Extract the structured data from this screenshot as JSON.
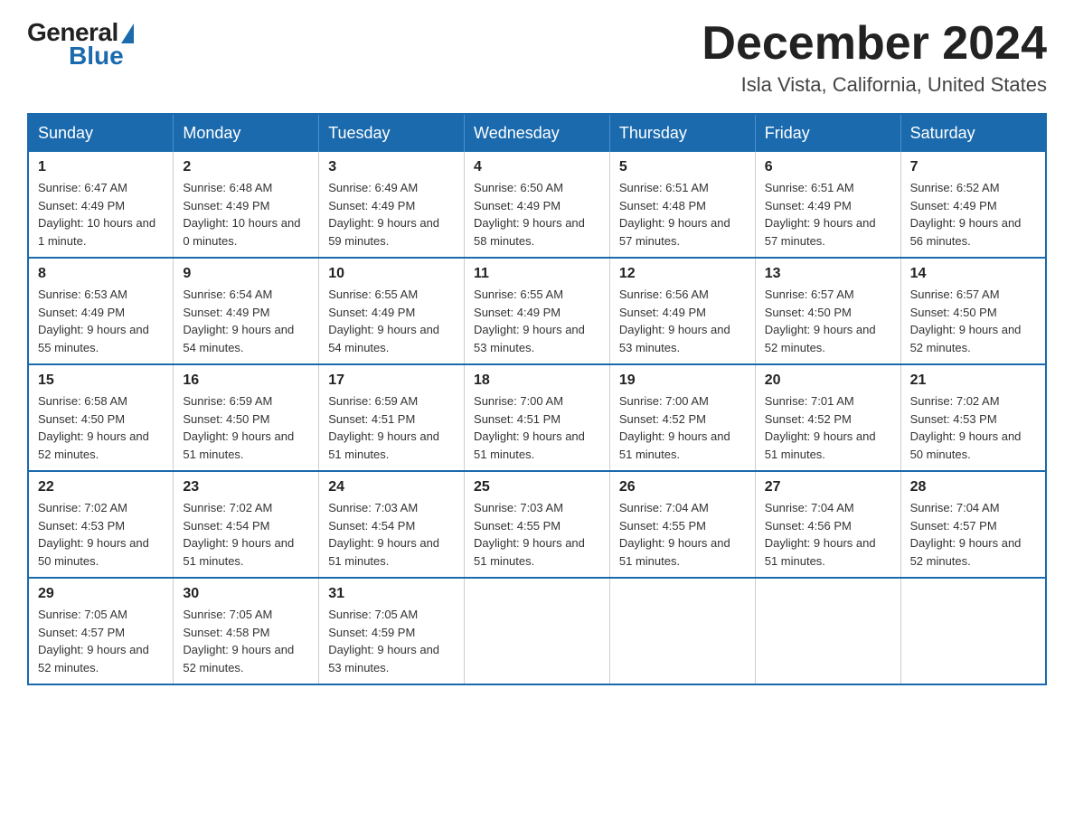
{
  "header": {
    "logo_general": "General",
    "logo_blue": "Blue",
    "month_title": "December 2024",
    "location": "Isla Vista, California, United States"
  },
  "weekdays": [
    "Sunday",
    "Monday",
    "Tuesday",
    "Wednesday",
    "Thursday",
    "Friday",
    "Saturday"
  ],
  "weeks": [
    [
      {
        "day": "1",
        "sunrise": "6:47 AM",
        "sunset": "4:49 PM",
        "daylight": "10 hours and 1 minute."
      },
      {
        "day": "2",
        "sunrise": "6:48 AM",
        "sunset": "4:49 PM",
        "daylight": "10 hours and 0 minutes."
      },
      {
        "day": "3",
        "sunrise": "6:49 AM",
        "sunset": "4:49 PM",
        "daylight": "9 hours and 59 minutes."
      },
      {
        "day": "4",
        "sunrise": "6:50 AM",
        "sunset": "4:49 PM",
        "daylight": "9 hours and 58 minutes."
      },
      {
        "day": "5",
        "sunrise": "6:51 AM",
        "sunset": "4:48 PM",
        "daylight": "9 hours and 57 minutes."
      },
      {
        "day": "6",
        "sunrise": "6:51 AM",
        "sunset": "4:49 PM",
        "daylight": "9 hours and 57 minutes."
      },
      {
        "day": "7",
        "sunrise": "6:52 AM",
        "sunset": "4:49 PM",
        "daylight": "9 hours and 56 minutes."
      }
    ],
    [
      {
        "day": "8",
        "sunrise": "6:53 AM",
        "sunset": "4:49 PM",
        "daylight": "9 hours and 55 minutes."
      },
      {
        "day": "9",
        "sunrise": "6:54 AM",
        "sunset": "4:49 PM",
        "daylight": "9 hours and 54 minutes."
      },
      {
        "day": "10",
        "sunrise": "6:55 AM",
        "sunset": "4:49 PM",
        "daylight": "9 hours and 54 minutes."
      },
      {
        "day": "11",
        "sunrise": "6:55 AM",
        "sunset": "4:49 PM",
        "daylight": "9 hours and 53 minutes."
      },
      {
        "day": "12",
        "sunrise": "6:56 AM",
        "sunset": "4:49 PM",
        "daylight": "9 hours and 53 minutes."
      },
      {
        "day": "13",
        "sunrise": "6:57 AM",
        "sunset": "4:50 PM",
        "daylight": "9 hours and 52 minutes."
      },
      {
        "day": "14",
        "sunrise": "6:57 AM",
        "sunset": "4:50 PM",
        "daylight": "9 hours and 52 minutes."
      }
    ],
    [
      {
        "day": "15",
        "sunrise": "6:58 AM",
        "sunset": "4:50 PM",
        "daylight": "9 hours and 52 minutes."
      },
      {
        "day": "16",
        "sunrise": "6:59 AM",
        "sunset": "4:50 PM",
        "daylight": "9 hours and 51 minutes."
      },
      {
        "day": "17",
        "sunrise": "6:59 AM",
        "sunset": "4:51 PM",
        "daylight": "9 hours and 51 minutes."
      },
      {
        "day": "18",
        "sunrise": "7:00 AM",
        "sunset": "4:51 PM",
        "daylight": "9 hours and 51 minutes."
      },
      {
        "day": "19",
        "sunrise": "7:00 AM",
        "sunset": "4:52 PM",
        "daylight": "9 hours and 51 minutes."
      },
      {
        "day": "20",
        "sunrise": "7:01 AM",
        "sunset": "4:52 PM",
        "daylight": "9 hours and 51 minutes."
      },
      {
        "day": "21",
        "sunrise": "7:02 AM",
        "sunset": "4:53 PM",
        "daylight": "9 hours and 50 minutes."
      }
    ],
    [
      {
        "day": "22",
        "sunrise": "7:02 AM",
        "sunset": "4:53 PM",
        "daylight": "9 hours and 50 minutes."
      },
      {
        "day": "23",
        "sunrise": "7:02 AM",
        "sunset": "4:54 PM",
        "daylight": "9 hours and 51 minutes."
      },
      {
        "day": "24",
        "sunrise": "7:03 AM",
        "sunset": "4:54 PM",
        "daylight": "9 hours and 51 minutes."
      },
      {
        "day": "25",
        "sunrise": "7:03 AM",
        "sunset": "4:55 PM",
        "daylight": "9 hours and 51 minutes."
      },
      {
        "day": "26",
        "sunrise": "7:04 AM",
        "sunset": "4:55 PM",
        "daylight": "9 hours and 51 minutes."
      },
      {
        "day": "27",
        "sunrise": "7:04 AM",
        "sunset": "4:56 PM",
        "daylight": "9 hours and 51 minutes."
      },
      {
        "day": "28",
        "sunrise": "7:04 AM",
        "sunset": "4:57 PM",
        "daylight": "9 hours and 52 minutes."
      }
    ],
    [
      {
        "day": "29",
        "sunrise": "7:05 AM",
        "sunset": "4:57 PM",
        "daylight": "9 hours and 52 minutes."
      },
      {
        "day": "30",
        "sunrise": "7:05 AM",
        "sunset": "4:58 PM",
        "daylight": "9 hours and 52 minutes."
      },
      {
        "day": "31",
        "sunrise": "7:05 AM",
        "sunset": "4:59 PM",
        "daylight": "9 hours and 53 minutes."
      },
      null,
      null,
      null,
      null
    ]
  ]
}
